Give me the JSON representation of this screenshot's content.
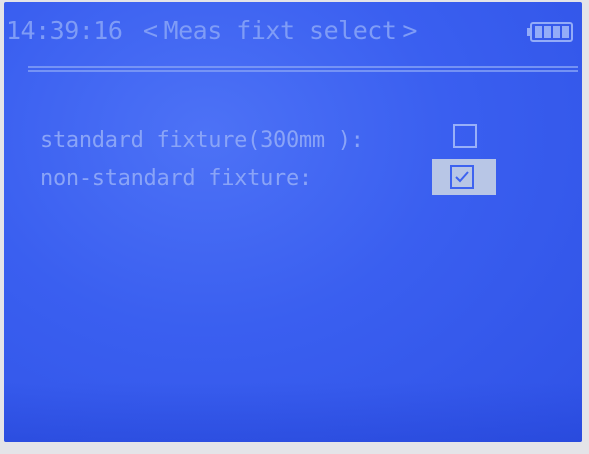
{
  "header": {
    "time": "14:39:16",
    "prev_arrow": "<",
    "title": "Meas fixt select",
    "next_arrow": ">",
    "battery_icon": "battery-full-icon"
  },
  "options": [
    {
      "label": "standard fixture(300mm ):",
      "checked": false
    },
    {
      "label": "non-standard fixture:",
      "checked": true,
      "selected": true
    }
  ],
  "colors": {
    "screen_background": "#3a5ff0",
    "text": "#8aa4f7",
    "selection_highlight": "#b8c6e6"
  }
}
